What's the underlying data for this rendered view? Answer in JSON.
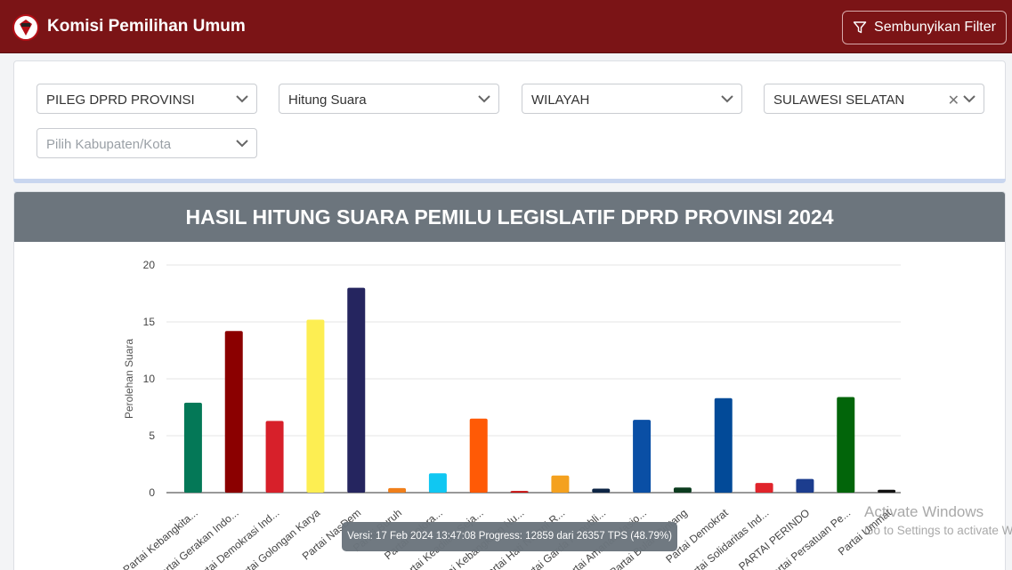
{
  "navbar": {
    "title": "Komisi Pemilihan Umum",
    "filter_button_label": "Sembunyikan Filter"
  },
  "filters": {
    "election_type": "PILEG DPRD PROVINSI",
    "mode": "Hitung Suara",
    "scope": "WILAYAH",
    "province": "SULAWESI SELATAN",
    "regency_placeholder": "Pilih Kabupaten/Kota"
  },
  "chart_header": "HASIL HITUNG SUARA PEMILU LEGISLATIF DPRD PROVINSI 2024",
  "chart_data": {
    "type": "bar",
    "title": "HASIL HITUNG SUARA PEMILU LEGISLATIF DPRD PROVINSI 2024",
    "xlabel": "",
    "ylabel": "Perolehan Suara",
    "ylim": [
      0,
      20
    ],
    "yticks": [
      0,
      5,
      10,
      15,
      20
    ],
    "grid": true,
    "categories": [
      "Partai Kebangkita...",
      "Partai Gerakan Indo...",
      "Partai Demokrasi Ind...",
      "Partai Golongan Karya",
      "Partai NasDem",
      "Partai Buruh",
      "Partai Gelora...",
      "Partai Keadilan Seja...",
      "Partai Kebangkitan Nu...",
      "Partai Hati Nurani R...",
      "Partai Garda Republi...",
      "Partai Amanat Nasio...",
      "Partai Bulan Bintang",
      "Partai Demokrat",
      "Partai Solidaritas Ind...",
      "PARTAI PERINDO",
      "Partai Persatuan Pe...",
      "Partai Ummat"
    ],
    "values": [
      7.9,
      14.2,
      6.3,
      15.2,
      18.0,
      0.4,
      1.7,
      6.5,
      0.15,
      1.5,
      0.35,
      6.4,
      0.45,
      8.3,
      0.85,
      1.2,
      8.4,
      0.25
    ],
    "colors": [
      "#047857",
      "#8b0000",
      "#d7202a",
      "#fdee52",
      "#25255f",
      "#f07f1b",
      "#10c7f2",
      "#ff5a06",
      "#c70d0d",
      "#f4a11f",
      "#0d2545",
      "#0a4fa5",
      "#0b3b1e",
      "#024a98",
      "#e0242b",
      "#1c3d8e",
      "#02650a",
      "#111111"
    ]
  },
  "tooltip": "Versi: 17 Feb 2024 13:47:08 Progress: 12859 dari 26357 TPS (48.79%)",
  "watermark": {
    "line1": "Activate Windows",
    "line2": "Go to Settings to activate Windows."
  }
}
